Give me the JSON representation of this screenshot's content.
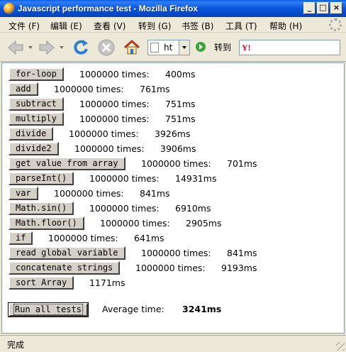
{
  "window": {
    "title": "Javascript performance test - Mozilla Firefox",
    "controls": {
      "minimize": "_",
      "maximize": "□",
      "close": "×"
    }
  },
  "menu": {
    "items": [
      "文件 (F)",
      "编辑 (E)",
      "查看 (V)",
      "转到 (G)",
      "书签 (B)",
      "工具 (T)",
      "帮助 (H)"
    ]
  },
  "navbar": {
    "url_text": "ht",
    "go_label": "转到",
    "search_logo": "Y!",
    "icons": [
      "back-arrow-icon",
      "forward-arrow-icon",
      "reload-icon",
      "stop-icon",
      "home-icon"
    ]
  },
  "tests": [
    {
      "label": "for-loop",
      "times": "1000000 times:",
      "ms": "400ms"
    },
    {
      "label": "add",
      "times": "1000000 times:",
      "ms": "761ms"
    },
    {
      "label": "subtract",
      "times": "1000000 times:",
      "ms": "751ms"
    },
    {
      "label": "multiply",
      "times": "1000000 times:",
      "ms": "751ms"
    },
    {
      "label": "divide",
      "times": "1000000 times:",
      "ms": "3926ms"
    },
    {
      "label": "divide2",
      "times": "1000000 times:",
      "ms": "3906ms"
    },
    {
      "label": "get value from array",
      "times": "1000000 times:",
      "ms": "701ms"
    },
    {
      "label": "parseInt()",
      "times": "1000000 times:",
      "ms": "14931ms"
    },
    {
      "label": "var",
      "times": "1000000 times:",
      "ms": "841ms"
    },
    {
      "label": "Math.sin()",
      "times": "1000000 times:",
      "ms": "6910ms"
    },
    {
      "label": "Math.floor()",
      "times": "1000000 times:",
      "ms": "2905ms"
    },
    {
      "label": "if",
      "times": "1000000 times:",
      "ms": "641ms"
    },
    {
      "label": "read global variable",
      "times": "1000000 times:",
      "ms": "841ms"
    },
    {
      "label": "concatenate strings",
      "times": "1000000 times:",
      "ms": "9193ms"
    },
    {
      "label": "sort Array",
      "times": "",
      "ms": "1171ms"
    }
  ],
  "run_all": {
    "label": "Run all tests",
    "average_label": "Average time:",
    "average_value": "3241ms"
  },
  "status": {
    "text": "完成"
  },
  "colors": {
    "titlebar": "#0a55d8",
    "chrome": "#ece9d8",
    "button_face": "#d4d0c8"
  }
}
